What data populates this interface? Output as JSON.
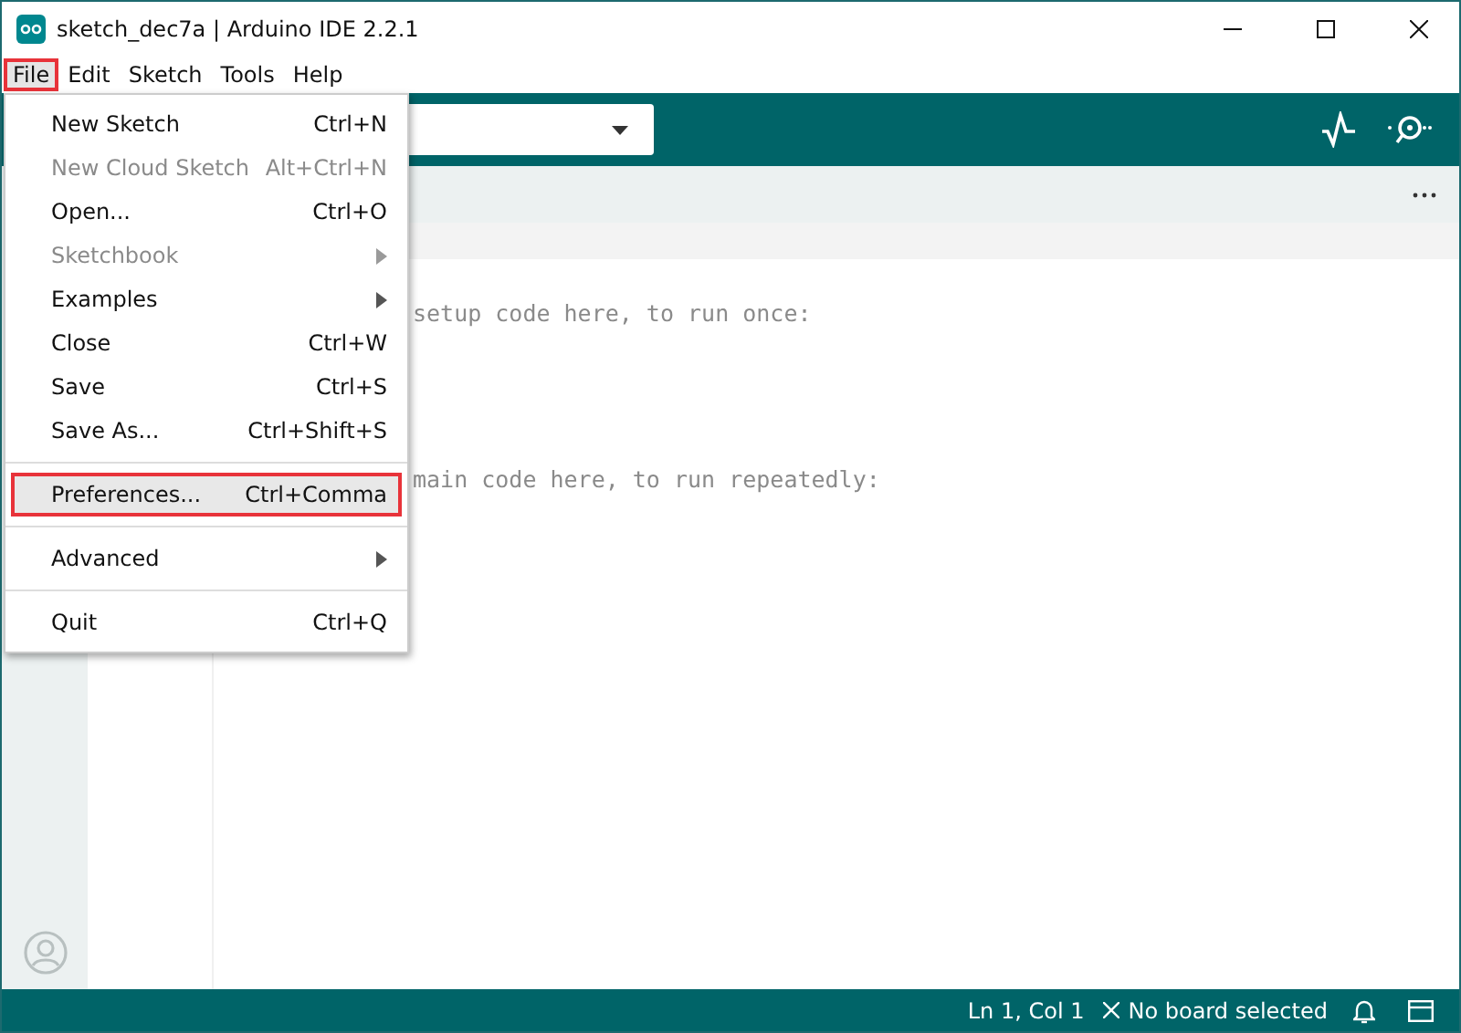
{
  "window": {
    "title": "sketch_dec7a | Arduino IDE 2.2.1"
  },
  "menubar": [
    {
      "label": "File",
      "selected": true,
      "outlined": true
    },
    {
      "label": "Edit",
      "selected": false,
      "outlined": false
    },
    {
      "label": "Sketch",
      "selected": false,
      "outlined": false
    },
    {
      "label": "Tools",
      "selected": false,
      "outlined": false
    },
    {
      "label": "Help",
      "selected": false,
      "outlined": false
    }
  ],
  "file_menu": [
    {
      "kind": "item",
      "label": "New Sketch",
      "shortcut": "Ctrl+N",
      "disabled": false,
      "submenu": false,
      "selected": false
    },
    {
      "kind": "item",
      "label": "New Cloud Sketch",
      "shortcut": "Alt+Ctrl+N",
      "disabled": true,
      "submenu": false,
      "selected": false
    },
    {
      "kind": "item",
      "label": "Open...",
      "shortcut": "Ctrl+O",
      "disabled": false,
      "submenu": false,
      "selected": false
    },
    {
      "kind": "item",
      "label": "Sketchbook",
      "disabled": true,
      "submenu": true,
      "selected": false
    },
    {
      "kind": "item",
      "label": "Examples",
      "disabled": false,
      "submenu": true,
      "selected": false
    },
    {
      "kind": "item",
      "label": "Close",
      "shortcut": "Ctrl+W",
      "disabled": false,
      "submenu": false,
      "selected": false
    },
    {
      "kind": "item",
      "label": "Save",
      "shortcut": "Ctrl+S",
      "disabled": false,
      "submenu": false,
      "selected": false
    },
    {
      "kind": "item",
      "label": "Save As...",
      "shortcut": "Ctrl+Shift+S",
      "disabled": false,
      "submenu": false,
      "selected": false
    },
    {
      "kind": "separator"
    },
    {
      "kind": "item",
      "label": "Preferences...",
      "shortcut": "Ctrl+Comma",
      "disabled": false,
      "submenu": false,
      "selected": true,
      "outlined": true
    },
    {
      "kind": "separator"
    },
    {
      "kind": "item",
      "label": "Advanced",
      "disabled": false,
      "submenu": true,
      "selected": false
    },
    {
      "kind": "separator"
    },
    {
      "kind": "item",
      "label": "Quit",
      "shortcut": "Ctrl+Q",
      "disabled": false,
      "submenu": false,
      "selected": false
    }
  ],
  "editor": {
    "lines": [
      {
        "text": "setup code here, to run once:"
      },
      {
        "text": "main code here, to run repeatedly:"
      }
    ]
  },
  "status_bar": {
    "position": "Ln 1, Col 1",
    "board": "No board selected"
  }
}
